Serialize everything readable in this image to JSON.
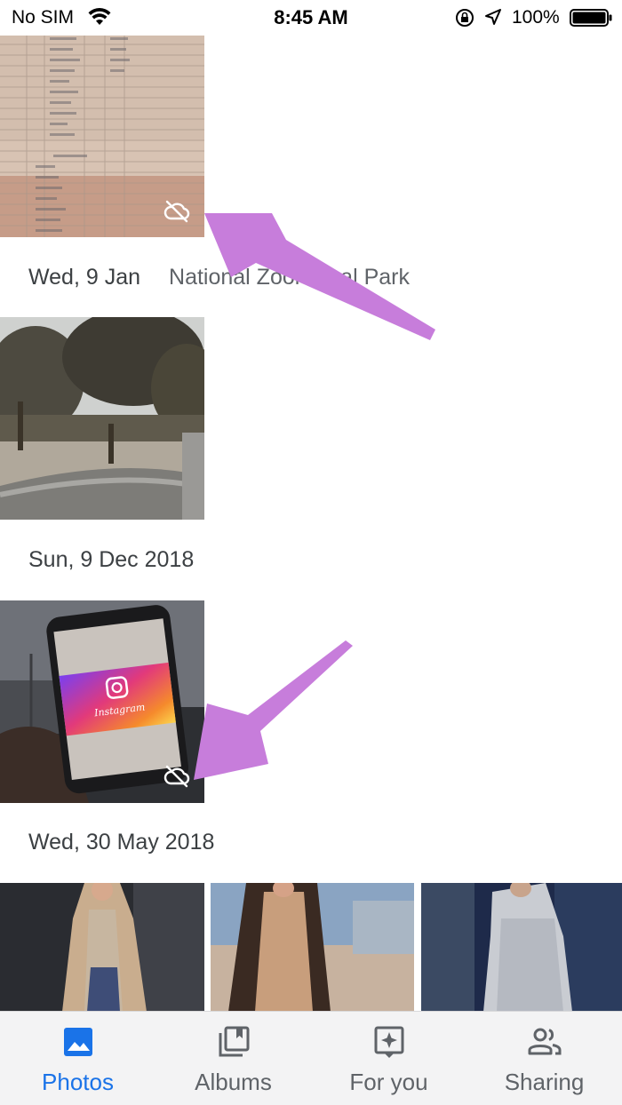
{
  "status_bar": {
    "carrier": "No SIM",
    "time": "8:45 AM",
    "battery_percent": "100%",
    "battery_level": 1.0
  },
  "sections": [
    {
      "date": "Wed, 9 Jan",
      "place": "National Zoological Park"
    },
    {
      "date": "Sun, 9 Dec 2018",
      "place": ""
    },
    {
      "date": "Wed, 30 May 2018",
      "place": ""
    }
  ],
  "photos": [
    {
      "description_icon": "document-photo",
      "cloud_status": "not-backed-up"
    },
    {
      "description_icon": "park-photo",
      "cloud_status": ""
    },
    {
      "description_icon": "phone-instagram-photo",
      "cloud_status": "not-backed-up"
    },
    {
      "description_icon": "fashion-photo-1",
      "cloud_status": ""
    },
    {
      "description_icon": "fashion-photo-2",
      "cloud_status": ""
    },
    {
      "description_icon": "fashion-photo-3",
      "cloud_status": ""
    }
  ],
  "instagram_screen_text": "Instagram",
  "annotation_color": "#c77ddb",
  "bottom_nav": {
    "tabs": [
      {
        "label": "Photos",
        "icon": "photos-icon",
        "active": true
      },
      {
        "label": "Albums",
        "icon": "albums-icon",
        "active": false
      },
      {
        "label": "For you",
        "icon": "for-you-icon",
        "active": false
      },
      {
        "label": "Sharing",
        "icon": "sharing-icon",
        "active": false
      }
    ],
    "active_color": "#1a73e8",
    "inactive_color": "#5f6368"
  }
}
